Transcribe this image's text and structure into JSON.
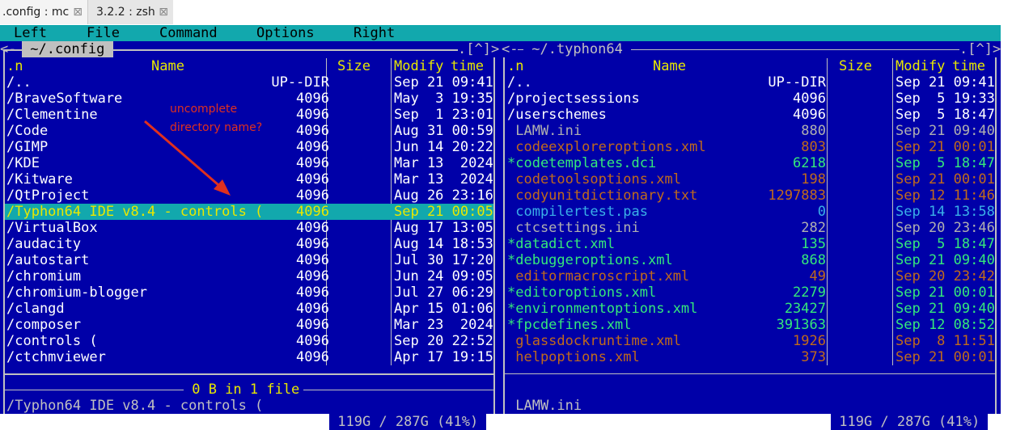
{
  "tabs": [
    {
      "title": ".config : mc",
      "active": true
    },
    {
      "title": "3.2.2 : zsh",
      "active": false
    }
  ],
  "menu": [
    "Left",
    "File",
    "Command",
    "Options",
    "Right"
  ],
  "left_panel": {
    "path": " ~/.config ",
    "corner": ".[^]>",
    "columns": {
      "n": ".n",
      "name": "Name",
      "size": "Size",
      "modify": "Modify",
      "time": "time"
    },
    "rows": [
      {
        "name": "/..",
        "size": "UP--DIR",
        "date": "Sep 21 09:41"
      },
      {
        "name": "/BraveSoftware",
        "size": "4096",
        "date": "May  3 19:35"
      },
      {
        "name": "/Clementine",
        "size": "4096",
        "date": "Sep  1 23:01"
      },
      {
        "name": "/Code",
        "size": "4096",
        "date": "Aug 31 00:59"
      },
      {
        "name": "/GIMP",
        "size": "4096",
        "date": "Jun 14 20:22"
      },
      {
        "name": "/KDE",
        "size": "4096",
        "date": "Mar 13  2024"
      },
      {
        "name": "/Kitware",
        "size": "4096",
        "date": "Mar 13  2024"
      },
      {
        "name": "/QtProject",
        "size": "4096",
        "date": "Aug 26 23:16"
      },
      {
        "name": "/Typhon64 IDE v8.4 - controls (",
        "size": "4096",
        "date": "Sep 21 00:05",
        "selected": true
      },
      {
        "name": "/VirtualBox",
        "size": "4096",
        "date": "Aug 17 13:05"
      },
      {
        "name": "/audacity",
        "size": "4096",
        "date": "Aug 14 18:53"
      },
      {
        "name": "/autostart",
        "size": "4096",
        "date": "Jul 30 17:20"
      },
      {
        "name": "/chromium",
        "size": "4096",
        "date": "Jun 24 09:05"
      },
      {
        "name": "/chromium-blogger",
        "size": "4096",
        "date": "Jul 27 06:29"
      },
      {
        "name": "/clangd",
        "size": "4096",
        "date": "Apr 15 01:06"
      },
      {
        "name": "/composer",
        "size": "4096",
        "date": "Mar 23  2024"
      },
      {
        "name": "/controls (",
        "size": "4096",
        "date": "Sep 20 22:52"
      },
      {
        "name": "/ctchmviewer",
        "size": "4096",
        "date": "Apr 17 19:15"
      }
    ],
    "summary": " 0 B in 1 file ",
    "mini_status": "/Typhon64 IDE v8.4 - controls (",
    "disk": " 119G / 287G (41%) "
  },
  "right_panel": {
    "path": " ~/.typhon64 ",
    "corner": ".[^]>",
    "columns": {
      "n": ".n",
      "name": "Name",
      "size": "Size",
      "modify": "Modify",
      "time": "time"
    },
    "rows": [
      {
        "name": "/..",
        "size": "UP--DIR",
        "date": "Sep 21 09:41",
        "color": "white"
      },
      {
        "name": "/projectsessions",
        "size": "4096",
        "date": "Sep  5 19:33",
        "color": "white"
      },
      {
        "name": "/userschemes",
        "size": "4096",
        "date": "Sep  5 18:47",
        "color": "white"
      },
      {
        "name": " LAMW.ini",
        "size": "880",
        "date": "Sep 21 09:40",
        "color": "grey"
      },
      {
        "name": " codeexploreroptions.xml",
        "size": "803",
        "date": "Sep 21 00:01",
        "color": "brown"
      },
      {
        "name": "*codetemplates.dci",
        "size": "6218",
        "date": "Sep  5 18:47",
        "color": "green"
      },
      {
        "name": " codetoolsoptions.xml",
        "size": "198",
        "date": "Sep 21 00:01",
        "color": "brown"
      },
      {
        "name": " codyunitdictionary.txt",
        "size": "1297883",
        "date": "Sep 12 11:46",
        "color": "brown"
      },
      {
        "name": " compilertest.pas",
        "size": "0",
        "date": "Sep 14 13:58",
        "color": "cyan"
      },
      {
        "name": " ctcsettings.ini",
        "size": "282",
        "date": "Sep 20 23:46",
        "color": "grey"
      },
      {
        "name": "*datadict.xml",
        "size": "135",
        "date": "Sep  5 18:47",
        "color": "green"
      },
      {
        "name": "*debuggeroptions.xml",
        "size": "868",
        "date": "Sep 21 09:40",
        "color": "green"
      },
      {
        "name": " editormacroscript.xml",
        "size": "49",
        "date": "Sep 20 23:42",
        "color": "brown"
      },
      {
        "name": "*editoroptions.xml",
        "size": "2279",
        "date": "Sep 21 00:01",
        "color": "green"
      },
      {
        "name": "*environmentoptions.xml",
        "size": "23427",
        "date": "Sep 21 09:40",
        "color": "green"
      },
      {
        "name": "*fpcdefines.xml",
        "size": "391363",
        "date": "Sep 12 08:52",
        "color": "green"
      },
      {
        "name": " glassdockruntime.xml",
        "size": "1926",
        "date": "Sep  8 11:51",
        "color": "brown"
      },
      {
        "name": " helpoptions.xml",
        "size": "373",
        "date": "Sep 21 00:01",
        "color": "brown"
      }
    ],
    "mini_status": " LAMW.ini",
    "disk": " 119G / 287G (41%) "
  },
  "annotation": {
    "line1": "uncomplete",
    "line2": "directory name?"
  },
  "colors": {
    "bg": "#0000a8",
    "menu": "#12a8ad",
    "header": "#e8e800",
    "annotation": "#e0301e"
  }
}
